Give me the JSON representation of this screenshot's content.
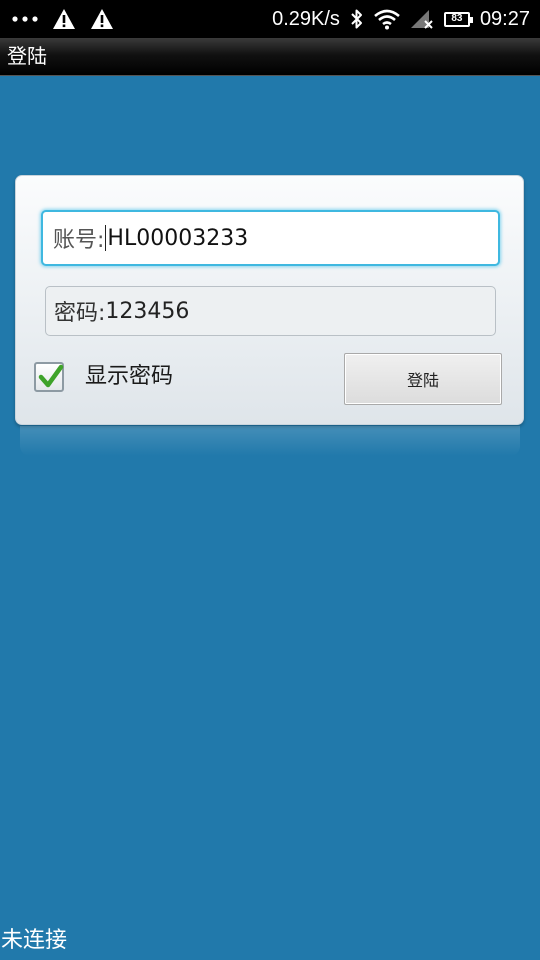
{
  "status_bar": {
    "net_speed": "0.29K/s",
    "battery_level": "83",
    "time": "09:27",
    "icons": [
      "more-dots-icon",
      "warning-icon",
      "warning-icon",
      "bluetooth-icon",
      "wifi-icon",
      "signal-icon",
      "battery-icon"
    ]
  },
  "title_bar": {
    "title": "登陆"
  },
  "login_form": {
    "account_label": "账号:",
    "account_value": "HL00003233",
    "password_label": "密码:",
    "password_value": "123456",
    "show_password_label": "显示密码",
    "show_password_checked": true,
    "login_button_label": "登陆"
  },
  "footer": {
    "connection_status": "未连接"
  },
  "colors": {
    "background": "#2179ab",
    "focus_border": "#3fb8e0",
    "check_green": "#3fa32a"
  }
}
